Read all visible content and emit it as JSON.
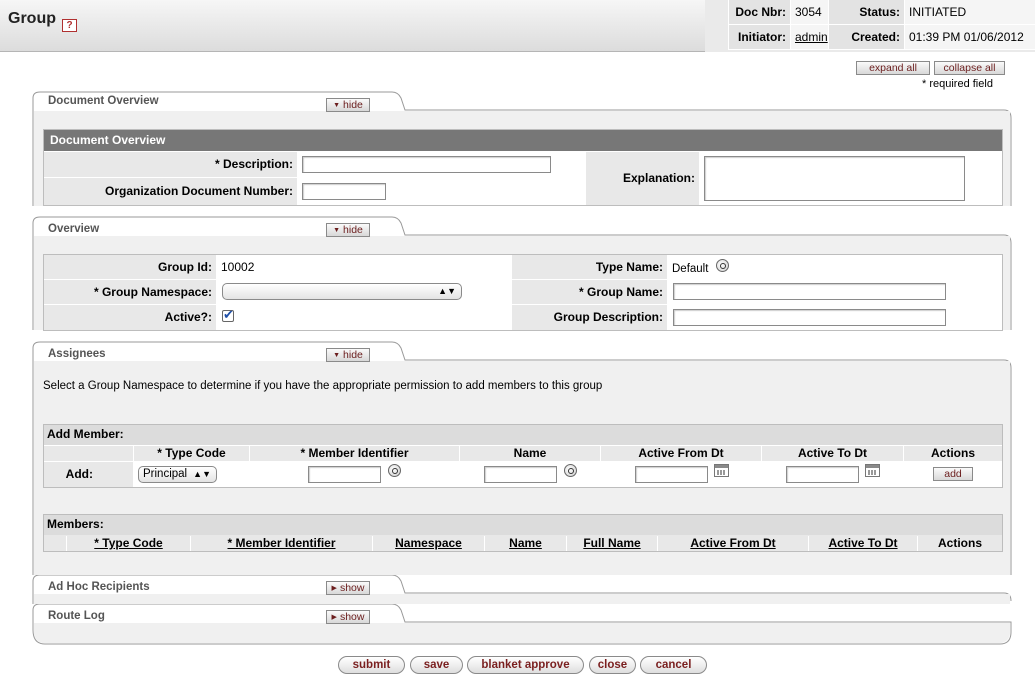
{
  "header": {
    "title": "Group",
    "help": "?",
    "doc_nbr_label": "Doc Nbr:",
    "doc_nbr": "3054",
    "status_label": "Status:",
    "status": "INITIATED",
    "initiator_label": "Initiator:",
    "initiator": "admin",
    "created_label": "Created:",
    "created": "01:39 PM 01/06/2012"
  },
  "controls": {
    "expand_all": "expand all",
    "collapse_all": "collapse all",
    "required_note": "* required field"
  },
  "tabs": {
    "document_overview": "Document Overview",
    "overview": "Overview",
    "assignees": "Assignees",
    "ad_hoc": "Ad Hoc Recipients",
    "route_log": "Route Log",
    "hide": "hide",
    "show": "show"
  },
  "document_overview": {
    "header": "Document Overview",
    "description_label": "* Description:",
    "description_value": "",
    "org_doc_label": "Organization Document Number:",
    "org_doc_value": "",
    "explanation_label": "Explanation:",
    "explanation_value": ""
  },
  "overview": {
    "group_id_label": "Group Id:",
    "group_id": "10002",
    "namespace_label": "* Group Namespace:",
    "namespace_value": "",
    "active_label": "Active?:",
    "type_name_label": "Type Name:",
    "type_name": "Default",
    "group_name_label": "* Group Name:",
    "group_name_value": "",
    "group_desc_label": "Group Description:",
    "group_desc_value": ""
  },
  "assignees": {
    "instruction": "Select a Group Namespace to determine if you have the appropriate permission to add members to this group",
    "add_member_header": "Add Member:",
    "add_columns": [
      "* Type Code",
      "* Member Identifier",
      "Name",
      "Active From Dt",
      "Active To Dt",
      "Actions"
    ],
    "add_row_label": "Add:",
    "type_code_value": "Principal",
    "add_button": "add",
    "members_header": "Members:",
    "member_columns": [
      "* Type Code",
      "* Member Identifier",
      "Namespace",
      "Name",
      "Full Name",
      "Active From Dt",
      "Active To Dt",
      "Actions"
    ]
  },
  "footer_buttons": {
    "submit": "submit",
    "save": "save",
    "blanket_approve": "blanket approve",
    "close": "close",
    "cancel": "cancel"
  }
}
